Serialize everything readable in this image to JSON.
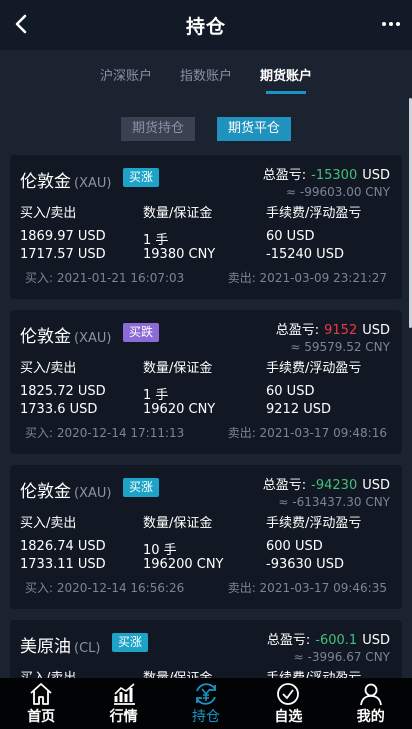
{
  "header": {
    "title": "持仓"
  },
  "tabs": [
    {
      "label": "沪深账户"
    },
    {
      "label": "指数账户"
    },
    {
      "label": "期货账户"
    }
  ],
  "subtabs": [
    {
      "label": "期货持仓"
    },
    {
      "label": "期货平仓"
    }
  ],
  "labels": {
    "total_pnl": "总盈亏:",
    "buy_sell": "买入/卖出",
    "qty_margin": "数量/保证金",
    "fee_float": "手续费/浮动盈亏"
  },
  "positions": [
    {
      "name": "伦敦金",
      "code": "(XAU)",
      "direction": "买涨",
      "pnl": "-15300",
      "pnl_unit": "USD",
      "cny": "≈ -99603.00 CNY",
      "buy": "1869.97 USD",
      "sell": "1717.57 USD",
      "qty": "1 手",
      "margin": "19380 CNY",
      "fee": "60 USD",
      "float_pnl": "-15240 USD",
      "buy_time": "买入: 2021-01-21 16:07:03",
      "sell_time": "卖出: 2021-03-09 23:21:27"
    },
    {
      "name": "伦敦金",
      "code": "(XAU)",
      "direction": "买跌",
      "pnl": "9152",
      "pnl_unit": "USD",
      "cny": "≈ 59579.52 CNY",
      "buy": "1825.72 USD",
      "sell": "1733.6 USD",
      "qty": "1 手",
      "margin": "19620 CNY",
      "fee": "60 USD",
      "float_pnl": "9212 USD",
      "buy_time": "买入: 2020-12-14 17:11:13",
      "sell_time": "卖出: 2021-03-17 09:48:16"
    },
    {
      "name": "伦敦金",
      "code": "(XAU)",
      "direction": "买涨",
      "pnl": "-94230",
      "pnl_unit": "USD",
      "cny": "≈ -613437.30 CNY",
      "buy": "1826.74 USD",
      "sell": "1733.11 USD",
      "qty": "10 手",
      "margin": "196200 CNY",
      "fee": "600 USD",
      "float_pnl": "-93630 USD",
      "buy_time": "买入: 2020-12-14 16:56:26",
      "sell_time": "卖出: 2021-03-17 09:46:35"
    },
    {
      "name": "美原油",
      "code": "(CL)",
      "direction": "买涨",
      "pnl": "-600.1",
      "pnl_unit": "USD",
      "cny": "≈ -3996.67 CNY",
      "buy": "",
      "sell": "",
      "qty": "",
      "margin": "",
      "fee": "",
      "float_pnl": "",
      "buy_time": "",
      "sell_time": ""
    }
  ],
  "nav": [
    {
      "label": "首页",
      "icon": "home-icon"
    },
    {
      "label": "行情",
      "icon": "chart-icon"
    },
    {
      "label": "持仓",
      "icon": "yen-icon"
    },
    {
      "label": "自选",
      "icon": "check-circle-icon"
    },
    {
      "label": "我的",
      "icon": "user-icon"
    }
  ],
  "colors": {
    "accent": "#1a94c8",
    "loss": "#43c07a",
    "gain": "#ea3943"
  }
}
